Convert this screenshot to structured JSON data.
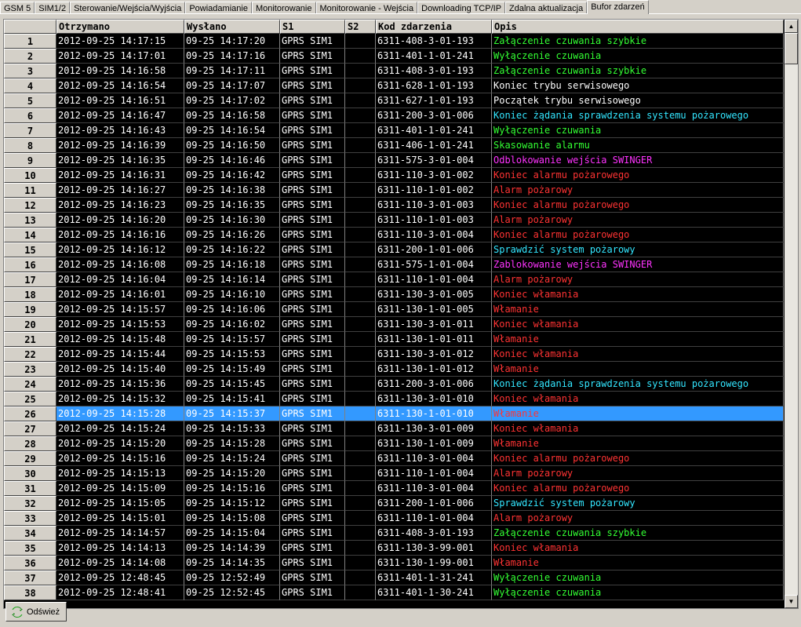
{
  "tabs": [
    "GSM 5",
    "SIM1/2",
    "Sterowanie/Wejścia/Wyjścia",
    "Powiadamianie",
    "Monitorowanie",
    "Monitorowanie - Wejścia",
    "Downloading TCP/IP",
    "Zdalna aktualizacja",
    "Bufor zdarzeń"
  ],
  "active_tab": "Bufor zdarzeń",
  "columns": [
    "",
    "Otrzymano",
    "Wysłano",
    "S1",
    "S2",
    "Kod zdarzenia",
    "Opis"
  ],
  "colors": {
    "green": "#33ff33",
    "white": "#ffffff",
    "cyan": "#33e6ff",
    "magenta": "#ff33ff",
    "red": "#ff3333"
  },
  "selected_row": "26",
  "rows": [
    {
      "n": "1",
      "rx": "2012-09-25 14:17:15",
      "tx": "09-25 14:17:20",
      "s1": "GPRS SIM1",
      "s2": "",
      "code": "6311-408-3-01-193",
      "desc": "Załączenie czuwania szybkie",
      "color": "green"
    },
    {
      "n": "2",
      "rx": "2012-09-25 14:17:01",
      "tx": "09-25 14:17:16",
      "s1": "GPRS SIM1",
      "s2": "",
      "code": "6311-401-1-01-241",
      "desc": "Wyłączenie czuwania",
      "color": "green"
    },
    {
      "n": "3",
      "rx": "2012-09-25 14:16:58",
      "tx": "09-25 14:17:11",
      "s1": "GPRS SIM1",
      "s2": "",
      "code": "6311-408-3-01-193",
      "desc": "Załączenie czuwania szybkie",
      "color": "green"
    },
    {
      "n": "4",
      "rx": "2012-09-25 14:16:54",
      "tx": "09-25 14:17:07",
      "s1": "GPRS SIM1",
      "s2": "",
      "code": "6311-628-1-01-193",
      "desc": "Koniec trybu serwisowego",
      "color": "white"
    },
    {
      "n": "5",
      "rx": "2012-09-25 14:16:51",
      "tx": "09-25 14:17:02",
      "s1": "GPRS SIM1",
      "s2": "",
      "code": "6311-627-1-01-193",
      "desc": "Początek trybu serwisowego",
      "color": "white"
    },
    {
      "n": "6",
      "rx": "2012-09-25 14:16:47",
      "tx": "09-25 14:16:58",
      "s1": "GPRS SIM1",
      "s2": "",
      "code": "6311-200-3-01-006",
      "desc": "Koniec żądania sprawdzenia systemu pożarowego",
      "color": "cyan"
    },
    {
      "n": "7",
      "rx": "2012-09-25 14:16:43",
      "tx": "09-25 14:16:54",
      "s1": "GPRS SIM1",
      "s2": "",
      "code": "6311-401-1-01-241",
      "desc": "Wyłączenie czuwania",
      "color": "green"
    },
    {
      "n": "8",
      "rx": "2012-09-25 14:16:39",
      "tx": "09-25 14:16:50",
      "s1": "GPRS SIM1",
      "s2": "",
      "code": "6311-406-1-01-241",
      "desc": "Skasowanie alarmu",
      "color": "green"
    },
    {
      "n": "9",
      "rx": "2012-09-25 14:16:35",
      "tx": "09-25 14:16:46",
      "s1": "GPRS SIM1",
      "s2": "",
      "code": "6311-575-3-01-004",
      "desc": "Odblokowanie wejścia SWINGER",
      "color": "magenta"
    },
    {
      "n": "10",
      "rx": "2012-09-25 14:16:31",
      "tx": "09-25 14:16:42",
      "s1": "GPRS SIM1",
      "s2": "",
      "code": "6311-110-3-01-002",
      "desc": "Koniec alarmu pożarowego",
      "color": "red"
    },
    {
      "n": "11",
      "rx": "2012-09-25 14:16:27",
      "tx": "09-25 14:16:38",
      "s1": "GPRS SIM1",
      "s2": "",
      "code": "6311-110-1-01-002",
      "desc": "Alarm pożarowy",
      "color": "red"
    },
    {
      "n": "12",
      "rx": "2012-09-25 14:16:23",
      "tx": "09-25 14:16:35",
      "s1": "GPRS SIM1",
      "s2": "",
      "code": "6311-110-3-01-003",
      "desc": "Koniec alarmu pożarowego",
      "color": "red"
    },
    {
      "n": "13",
      "rx": "2012-09-25 14:16:20",
      "tx": "09-25 14:16:30",
      "s1": "GPRS SIM1",
      "s2": "",
      "code": "6311-110-1-01-003",
      "desc": "Alarm pożarowy",
      "color": "red"
    },
    {
      "n": "14",
      "rx": "2012-09-25 14:16:16",
      "tx": "09-25 14:16:26",
      "s1": "GPRS SIM1",
      "s2": "",
      "code": "6311-110-3-01-004",
      "desc": "Koniec alarmu pożarowego",
      "color": "red"
    },
    {
      "n": "15",
      "rx": "2012-09-25 14:16:12",
      "tx": "09-25 14:16:22",
      "s1": "GPRS SIM1",
      "s2": "",
      "code": "6311-200-1-01-006",
      "desc": "Sprawdzić system pożarowy",
      "color": "cyan"
    },
    {
      "n": "16",
      "rx": "2012-09-25 14:16:08",
      "tx": "09-25 14:16:18",
      "s1": "GPRS SIM1",
      "s2": "",
      "code": "6311-575-1-01-004",
      "desc": "Zablokowanie wejścia SWINGER",
      "color": "magenta"
    },
    {
      "n": "17",
      "rx": "2012-09-25 14:16:04",
      "tx": "09-25 14:16:14",
      "s1": "GPRS SIM1",
      "s2": "",
      "code": "6311-110-1-01-004",
      "desc": "Alarm pożarowy",
      "color": "red"
    },
    {
      "n": "18",
      "rx": "2012-09-25 14:16:01",
      "tx": "09-25 14:16:10",
      "s1": "GPRS SIM1",
      "s2": "",
      "code": "6311-130-3-01-005",
      "desc": "Koniec włamania",
      "color": "red"
    },
    {
      "n": "19",
      "rx": "2012-09-25 14:15:57",
      "tx": "09-25 14:16:06",
      "s1": "GPRS SIM1",
      "s2": "",
      "code": "6311-130-1-01-005",
      "desc": "Włamanie",
      "color": "red"
    },
    {
      "n": "20",
      "rx": "2012-09-25 14:15:53",
      "tx": "09-25 14:16:02",
      "s1": "GPRS SIM1",
      "s2": "",
      "code": "6311-130-3-01-011",
      "desc": "Koniec włamania",
      "color": "red"
    },
    {
      "n": "21",
      "rx": "2012-09-25 14:15:48",
      "tx": "09-25 14:15:57",
      "s1": "GPRS SIM1",
      "s2": "",
      "code": "6311-130-1-01-011",
      "desc": "Włamanie",
      "color": "red"
    },
    {
      "n": "22",
      "rx": "2012-09-25 14:15:44",
      "tx": "09-25 14:15:53",
      "s1": "GPRS SIM1",
      "s2": "",
      "code": "6311-130-3-01-012",
      "desc": "Koniec włamania",
      "color": "red"
    },
    {
      "n": "23",
      "rx": "2012-09-25 14:15:40",
      "tx": "09-25 14:15:49",
      "s1": "GPRS SIM1",
      "s2": "",
      "code": "6311-130-1-01-012",
      "desc": "Włamanie",
      "color": "red"
    },
    {
      "n": "24",
      "rx": "2012-09-25 14:15:36",
      "tx": "09-25 14:15:45",
      "s1": "GPRS SIM1",
      "s2": "",
      "code": "6311-200-3-01-006",
      "desc": "Koniec żądania sprawdzenia systemu pożarowego",
      "color": "cyan"
    },
    {
      "n": "25",
      "rx": "2012-09-25 14:15:32",
      "tx": "09-25 14:15:41",
      "s1": "GPRS SIM1",
      "s2": "",
      "code": "6311-130-3-01-010",
      "desc": "Koniec włamania",
      "color": "red"
    },
    {
      "n": "26",
      "rx": "2012-09-25 14:15:28",
      "tx": "09-25 14:15:37",
      "s1": "GPRS SIM1",
      "s2": "",
      "code": "6311-130-1-01-010",
      "desc": "Włamanie",
      "color": "red"
    },
    {
      "n": "27",
      "rx": "2012-09-25 14:15:24",
      "tx": "09-25 14:15:33",
      "s1": "GPRS SIM1",
      "s2": "",
      "code": "6311-130-3-01-009",
      "desc": "Koniec włamania",
      "color": "red"
    },
    {
      "n": "28",
      "rx": "2012-09-25 14:15:20",
      "tx": "09-25 14:15:28",
      "s1": "GPRS SIM1",
      "s2": "",
      "code": "6311-130-1-01-009",
      "desc": "Włamanie",
      "color": "red"
    },
    {
      "n": "29",
      "rx": "2012-09-25 14:15:16",
      "tx": "09-25 14:15:24",
      "s1": "GPRS SIM1",
      "s2": "",
      "code": "6311-110-3-01-004",
      "desc": "Koniec alarmu pożarowego",
      "color": "red"
    },
    {
      "n": "30",
      "rx": "2012-09-25 14:15:13",
      "tx": "09-25 14:15:20",
      "s1": "GPRS SIM1",
      "s2": "",
      "code": "6311-110-1-01-004",
      "desc": "Alarm pożarowy",
      "color": "red"
    },
    {
      "n": "31",
      "rx": "2012-09-25 14:15:09",
      "tx": "09-25 14:15:16",
      "s1": "GPRS SIM1",
      "s2": "",
      "code": "6311-110-3-01-004",
      "desc": "Koniec alarmu pożarowego",
      "color": "red"
    },
    {
      "n": "32",
      "rx": "2012-09-25 14:15:05",
      "tx": "09-25 14:15:12",
      "s1": "GPRS SIM1",
      "s2": "",
      "code": "6311-200-1-01-006",
      "desc": "Sprawdzić system pożarowy",
      "color": "cyan"
    },
    {
      "n": "33",
      "rx": "2012-09-25 14:15:01",
      "tx": "09-25 14:15:08",
      "s1": "GPRS SIM1",
      "s2": "",
      "code": "6311-110-1-01-004",
      "desc": "Alarm pożarowy",
      "color": "red"
    },
    {
      "n": "34",
      "rx": "2012-09-25 14:14:57",
      "tx": "09-25 14:15:04",
      "s1": "GPRS SIM1",
      "s2": "",
      "code": "6311-408-3-01-193",
      "desc": "Załączenie czuwania szybkie",
      "color": "green"
    },
    {
      "n": "35",
      "rx": "2012-09-25 14:14:13",
      "tx": "09-25 14:14:39",
      "s1": "GPRS SIM1",
      "s2": "",
      "code": "6311-130-3-99-001",
      "desc": "Koniec włamania",
      "color": "red"
    },
    {
      "n": "36",
      "rx": "2012-09-25 14:14:08",
      "tx": "09-25 14:14:35",
      "s1": "GPRS SIM1",
      "s2": "",
      "code": "6311-130-1-99-001",
      "desc": "Włamanie",
      "color": "red"
    },
    {
      "n": "37",
      "rx": "2012-09-25 12:48:45",
      "tx": "09-25 12:52:49",
      "s1": "GPRS SIM1",
      "s2": "",
      "code": "6311-401-1-31-241",
      "desc": "Wyłączenie czuwania",
      "color": "green"
    },
    {
      "n": "38",
      "rx": "2012-09-25 12:48:41",
      "tx": "09-25 12:52:45",
      "s1": "GPRS SIM1",
      "s2": "",
      "code": "6311-401-1-30-241",
      "desc": "Wyłączenie czuwania",
      "color": "green"
    }
  ],
  "refresh_label": "Odśwież",
  "scroll_up_icon": "up-arrow-icon",
  "scroll_down_icon": "down-arrow-icon"
}
